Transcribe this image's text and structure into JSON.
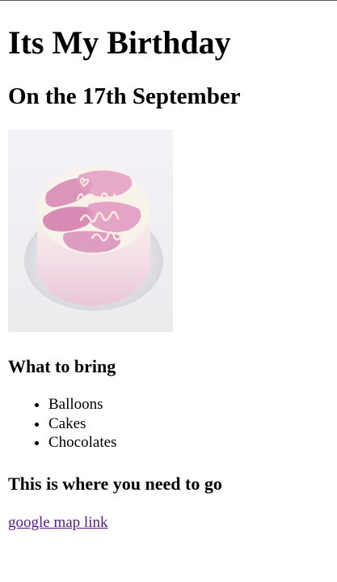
{
  "page": {
    "title": "Its My Birthday",
    "subtitle": "On the 17th September"
  },
  "image": {
    "alt": "cake",
    "cake_text": "happy birth day"
  },
  "bring": {
    "heading": "What to bring",
    "items": [
      "Balloons",
      "Cakes",
      "Chocolates"
    ]
  },
  "location": {
    "heading": "This is where you need to go",
    "link_text": "google map link"
  },
  "colors": {
    "link_visited": "#551a8b",
    "frosting_pink": "#d98cb8",
    "cake_cream": "#f7f1e8"
  }
}
